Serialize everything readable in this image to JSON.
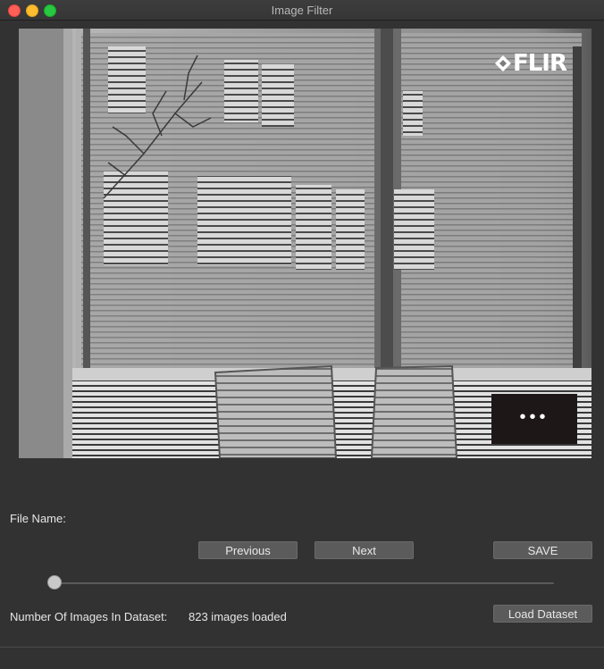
{
  "window": {
    "title": "Image Filter"
  },
  "image": {
    "logo_text": "FLIR",
    "overlay_icon": "more-horizontal-icon",
    "overlay_glyph": "•••"
  },
  "form": {
    "file_name_label": "File Name:",
    "file_name_value": "",
    "count_label": "Number Of Images In Dataset:",
    "count_value": "823 images loaded"
  },
  "buttons": {
    "previous": "Previous",
    "next": "Next",
    "save": "SAVE",
    "load_dataset": "Load Dataset"
  },
  "slider": {
    "value": 0
  },
  "colors": {
    "window_bg": "#323232",
    "button_bg": "#5b5b5b",
    "close": "#fe5f57",
    "minimize": "#febc2e",
    "maximize": "#28c840"
  }
}
